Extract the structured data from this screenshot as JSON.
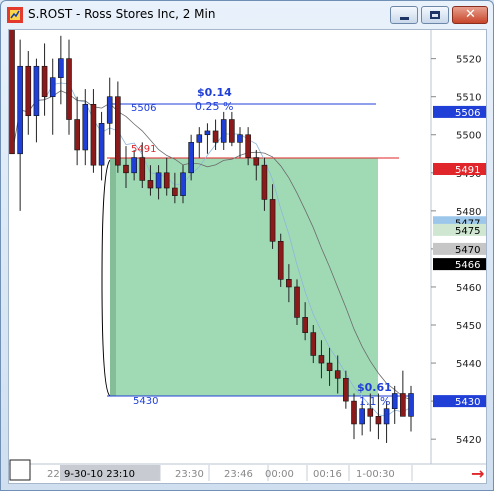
{
  "window": {
    "title": "S.ROST - Ross Stores Inc, 2 Min",
    "minimize_label": "minimize",
    "maximize_label": "maximize",
    "close_label": "close"
  },
  "chart_data": {
    "type": "candlestick",
    "title": "S.ROST - Ross Stores Inc, 2 Min",
    "price_axis": {
      "ticks": [
        "5520",
        "5510",
        "5500",
        "5490",
        "5480",
        "5470",
        "5460",
        "5450",
        "5440",
        "5430",
        "5420"
      ],
      "ylim": [
        5414,
        5527
      ]
    },
    "time_axis": {
      "labels": [
        "22",
        "9-30-10  23:10",
        "23:30",
        "23:46",
        "00:00",
        "00:16",
        "1-00:30"
      ]
    },
    "price_markers": [
      {
        "label": "5506",
        "color": "#1f3fd7",
        "text_color": "#ffffff"
      },
      {
        "label": "5491",
        "color": "#e0262a",
        "text_color": "#ffffff"
      },
      {
        "label": "5477",
        "color": "#9cc7ea",
        "text_color": "#000000"
      },
      {
        "label": "5475",
        "color": "#cfe6d1",
        "text_color": "#000000"
      },
      {
        "label": "5470",
        "color": "#c6c6c6",
        "text_color": "#000000"
      },
      {
        "label": "5466",
        "color": "#000000",
        "text_color": "#ffffff"
      },
      {
        "label": "5430",
        "color": "#1f3fd7",
        "text_color": "#ffffff"
      }
    ],
    "annotations": {
      "change_top": "$0.14",
      "pct_top": "0.25 %",
      "level_top": "5506",
      "level_red": "5491",
      "level_bottom": "5430",
      "change_bottom": "$0.61",
      "pct_bottom": "1.1 %"
    },
    "candles": [
      [
        5530,
        5540,
        5500,
        5495
      ],
      [
        5495,
        5525,
        5480,
        5518
      ],
      [
        5518,
        5522,
        5500,
        5505
      ],
      [
        5505,
        5520,
        5498,
        5518
      ],
      [
        5518,
        5524,
        5505,
        5510
      ],
      [
        5510,
        5520,
        5500,
        5515
      ],
      [
        5515,
        5526,
        5508,
        5520
      ],
      [
        5520,
        5525,
        5500,
        5504
      ],
      [
        5504,
        5510,
        5492,
        5496
      ],
      [
        5496,
        5512,
        5492,
        5508
      ],
      [
        5508,
        5512,
        5490,
        5492
      ],
      [
        5492,
        5506,
        5488,
        5503
      ],
      [
        5503,
        5515,
        5500,
        5510
      ],
      [
        5510,
        5514,
        5490,
        5492
      ],
      [
        5492,
        5497,
        5486,
        5490
      ],
      [
        5490,
        5496,
        5488,
        5494
      ],
      [
        5494,
        5498,
        5486,
        5488
      ],
      [
        5488,
        5492,
        5484,
        5486
      ],
      [
        5486,
        5492,
        5483,
        5490
      ],
      [
        5490,
        5494,
        5484,
        5486
      ],
      [
        5486,
        5490,
        5482,
        5484
      ],
      [
        5484,
        5492,
        5482,
        5490
      ],
      [
        5490,
        5500,
        5488,
        5498
      ],
      [
        5498,
        5502,
        5494,
        5500
      ],
      [
        5500,
        5503,
        5495,
        5501
      ],
      [
        5501,
        5504,
        5496,
        5498
      ],
      [
        5498,
        5506,
        5496,
        5504
      ],
      [
        5504,
        5506,
        5497,
        5498
      ],
      [
        5498,
        5502,
        5494,
        5500
      ],
      [
        5500,
        5502,
        5492,
        5494
      ],
      [
        5494,
        5496,
        5488,
        5492
      ],
      [
        5492,
        5494,
        5480,
        5483
      ],
      [
        5483,
        5487,
        5470,
        5472
      ],
      [
        5472,
        5474,
        5460,
        5462
      ],
      [
        5462,
        5466,
        5456,
        5460
      ],
      [
        5460,
        5462,
        5450,
        5452
      ],
      [
        5452,
        5456,
        5446,
        5448
      ],
      [
        5448,
        5450,
        5440,
        5442
      ],
      [
        5442,
        5446,
        5436,
        5440
      ],
      [
        5440,
        5444,
        5434,
        5438
      ],
      [
        5438,
        5442,
        5432,
        5436
      ],
      [
        5436,
        5438,
        5428,
        5430
      ],
      [
        5430,
        5432,
        5420,
        5424
      ],
      [
        5424,
        5430,
        5421,
        5428
      ],
      [
        5428,
        5432,
        5422,
        5426
      ],
      [
        5426,
        5432,
        5420,
        5424
      ],
      [
        5424,
        5430,
        5419,
        5428
      ],
      [
        5428,
        5434,
        5424,
        5432
      ],
      [
        5432,
        5438,
        5426,
        5426
      ],
      [
        5426,
        5434,
        5422,
        5432
      ]
    ]
  },
  "footer": {
    "scroll_arrow": "→"
  }
}
